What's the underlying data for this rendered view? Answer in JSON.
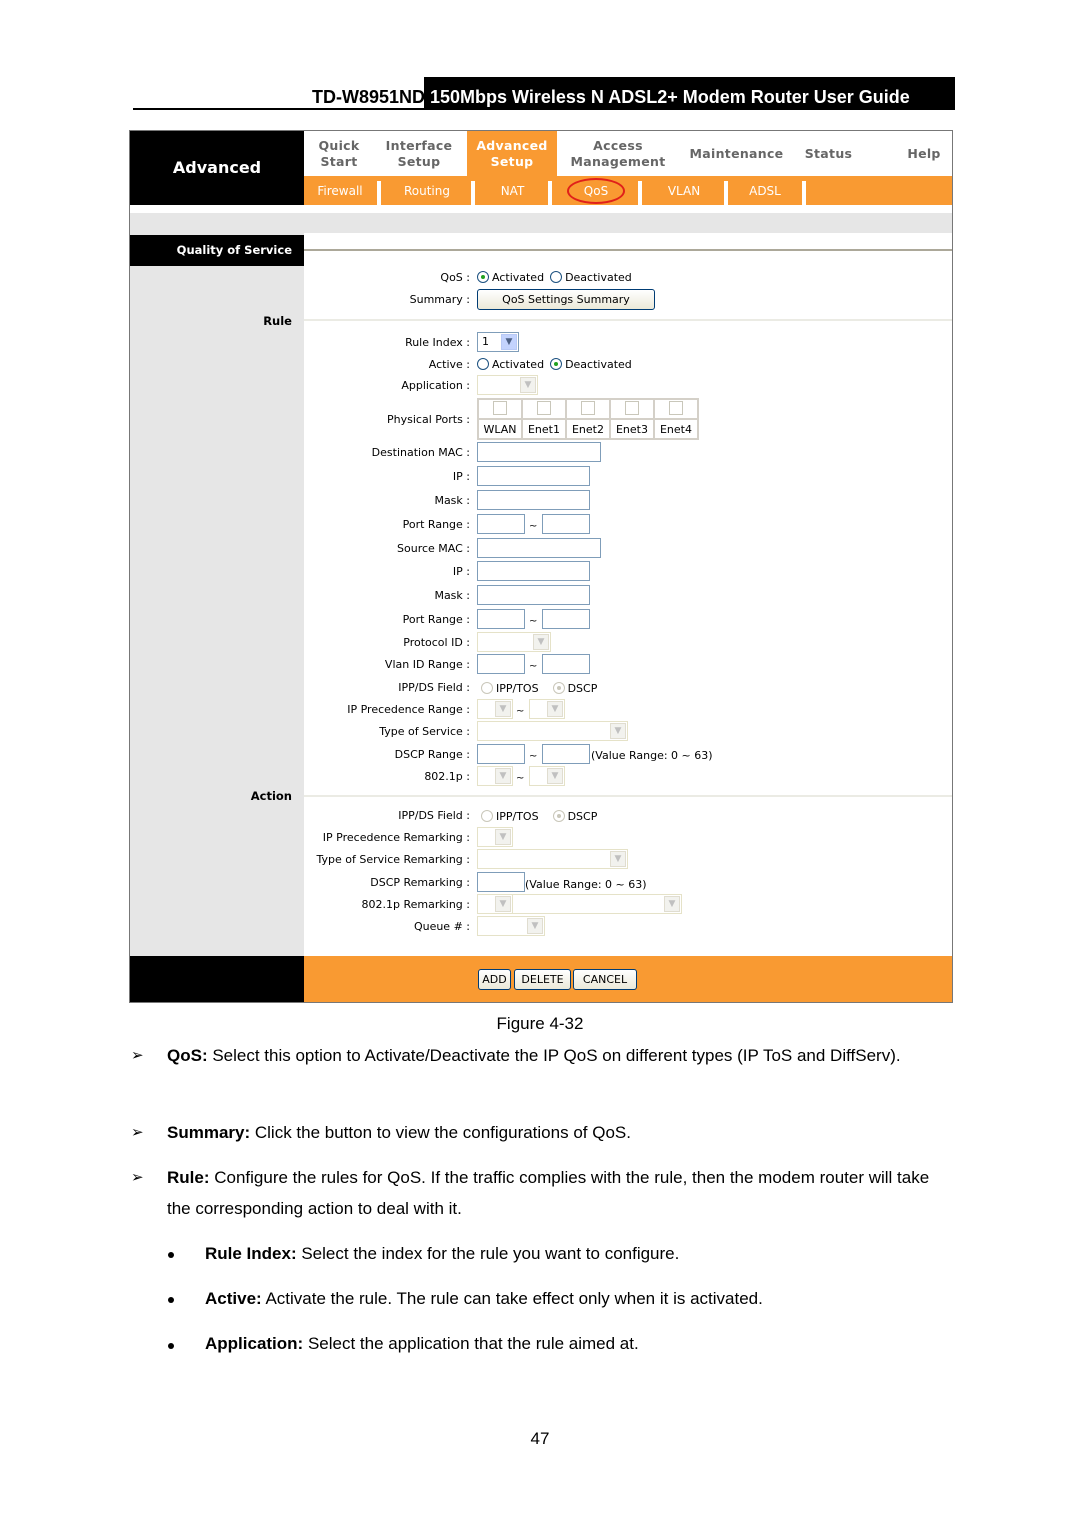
{
  "doc_header": {
    "model": "TD-W8951ND",
    "title": "150Mbps Wireless N ADSL2+ Modem Router User Guide"
  },
  "router_ui": {
    "brand": "Advanced",
    "top_nav": [
      {
        "label_1": "Quick",
        "label_2": "Start",
        "active": false
      },
      {
        "label_1": "Interface",
        "label_2": "Setup",
        "active": false
      },
      {
        "label_1": "Advanced",
        "label_2": "Setup",
        "active": true
      },
      {
        "label_1": "Access",
        "label_2": "Management",
        "active": false
      },
      {
        "label_1": "Maintenance",
        "label_2": "",
        "active": false
      },
      {
        "label_1": "Status",
        "label_2": "",
        "active": false
      },
      {
        "label_1": "Help",
        "label_2": "",
        "active": false
      }
    ],
    "sub_nav": [
      "Firewall",
      "Routing",
      "NAT",
      "QoS",
      "VLAN",
      "ADSL"
    ],
    "sub_nav_highlighted": "QoS",
    "section_title": "Quality of Service",
    "sections": {
      "rule": "Rule",
      "action": "Action"
    },
    "qos": {
      "label": "QoS :",
      "options": [
        "Activated",
        "Deactivated"
      ],
      "selected": "Activated"
    },
    "summary": {
      "label": "Summary :",
      "button": "QoS Settings Summary"
    },
    "rule": {
      "rule_index": {
        "label": "Rule Index :",
        "value": "1"
      },
      "active": {
        "label": "Active :",
        "options": [
          "Activated",
          "Deactivated"
        ],
        "selected": "Deactivated"
      },
      "application": {
        "label": "Application :",
        "value": ""
      },
      "physical_ports": {
        "label": "Physical Ports :",
        "ports": [
          "WLAN",
          "Enet1",
          "Enet2",
          "Enet3",
          "Enet4"
        ]
      },
      "destination_mac": {
        "label": "Destination MAC :",
        "value": ""
      },
      "dest_ip": {
        "label": "IP :",
        "value": ""
      },
      "dest_mask": {
        "label": "Mask :",
        "value": ""
      },
      "dest_port_range": {
        "label": "Port Range :",
        "from": "",
        "to": ""
      },
      "source_mac": {
        "label": "Source MAC :",
        "value": ""
      },
      "src_ip": {
        "label": "IP :",
        "value": ""
      },
      "src_mask": {
        "label": "Mask :",
        "value": ""
      },
      "src_port_range": {
        "label": "Port Range :",
        "from": "",
        "to": ""
      },
      "protocol_id": {
        "label": "Protocol ID :",
        "value": ""
      },
      "vlan_id_range": {
        "label": "Vlan ID Range :",
        "from": "",
        "to": ""
      },
      "ipp_ds_field": {
        "label": "IPP/DS Field :",
        "options": [
          "IPP/TOS",
          "DSCP"
        ],
        "selected": "DSCP"
      },
      "ip_precedence_range": {
        "label": "IP Precedence Range :"
      },
      "type_of_service": {
        "label": "Type of Service :"
      },
      "dscp_range": {
        "label": "DSCP Range :",
        "hint": "(Value Range: 0 ~ 63)"
      },
      "dot1p": {
        "label": "802.1p :"
      },
      "tilde": "~"
    },
    "action": {
      "ipp_ds_field": {
        "label": "IPP/DS Field :",
        "options": [
          "IPP/TOS",
          "DSCP"
        ],
        "selected": "DSCP"
      },
      "ip_precedence_remarking": {
        "label": "IP Precedence Remarking :"
      },
      "type_of_service_remarking": {
        "label": "Type of Service Remarking :"
      },
      "dscp_remarking": {
        "label": "DSCP Remarking :",
        "hint": "(Value Range: 0 ~ 63)"
      },
      "dot1p_remarking": {
        "label": "802.1p Remarking :"
      },
      "queue": {
        "label": "Queue # :"
      }
    },
    "buttons": {
      "add": "ADD",
      "delete": "DELETE",
      "cancel": "CANCEL"
    }
  },
  "figure_caption": "Figure 4-32",
  "descriptions": [
    {
      "term": "QoS:",
      "text": " Select this option to Activate/Deactivate the IP QoS on different types (IP ToS and DiffServ)."
    },
    {
      "term": "Summary:",
      "text": " Click the button to view the configurations of QoS."
    },
    {
      "term": "Rule:",
      "text": " Configure the rules for QoS. If the traffic complies with the rule, then the modem router will take the corresponding action to deal with it."
    }
  ],
  "sub_descriptions": [
    {
      "term": "Rule Index:",
      "text": " Select the index for the rule you want to configure."
    },
    {
      "term": "Active:",
      "text": " Activate the rule. The rule can take effect only when it is activated."
    },
    {
      "term": "Application:",
      "text": " Select the application that the rule aimed at."
    }
  ],
  "bullet_marker": "➢",
  "page_number": "47",
  "colors": {
    "accent_orange": "#f99a32",
    "highlight_circle": "#e0201a",
    "sidebar_grey": "#e6e6e6"
  }
}
